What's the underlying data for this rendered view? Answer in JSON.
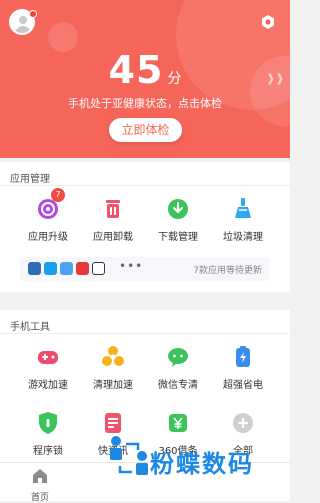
{
  "header": {
    "score": "45",
    "score_unit": "分",
    "status_text": "手机处于亚健康状态，点击体检",
    "check_button": "立即体检"
  },
  "app_management": {
    "title": "应用管理",
    "items": [
      {
        "label": "应用升级",
        "icon": "upgrade-icon",
        "badge": "7"
      },
      {
        "label": "应用卸载",
        "icon": "trash-icon"
      },
      {
        "label": "下载管理",
        "icon": "download-icon"
      },
      {
        "label": "垃圾清理",
        "icon": "broom-icon"
      }
    ],
    "update_text": "7款应用等待更新",
    "more": "•••"
  },
  "phone_tools": {
    "title": "手机工具",
    "items": [
      {
        "label": "游戏加速",
        "icon": "gamepad-icon"
      },
      {
        "label": "清理加速",
        "icon": "fan-icon"
      },
      {
        "label": "微信专清",
        "icon": "wechat-icon"
      },
      {
        "label": "超强省电",
        "icon": "battery-icon"
      },
      {
        "label": "程序锁",
        "icon": "shield-lock-icon"
      },
      {
        "label": "快资讯",
        "icon": "news-icon"
      },
      {
        "label": "360借条",
        "icon": "yuan-icon"
      },
      {
        "label": "全部",
        "icon": "plus-icon"
      }
    ]
  },
  "bottom_nav": {
    "home_label": "首页"
  },
  "watermark": {
    "text": "粉蝶数码"
  },
  "colors": {
    "hero": "#f5655a",
    "accent": "#f5655a",
    "watermark": "#1e88e5"
  }
}
